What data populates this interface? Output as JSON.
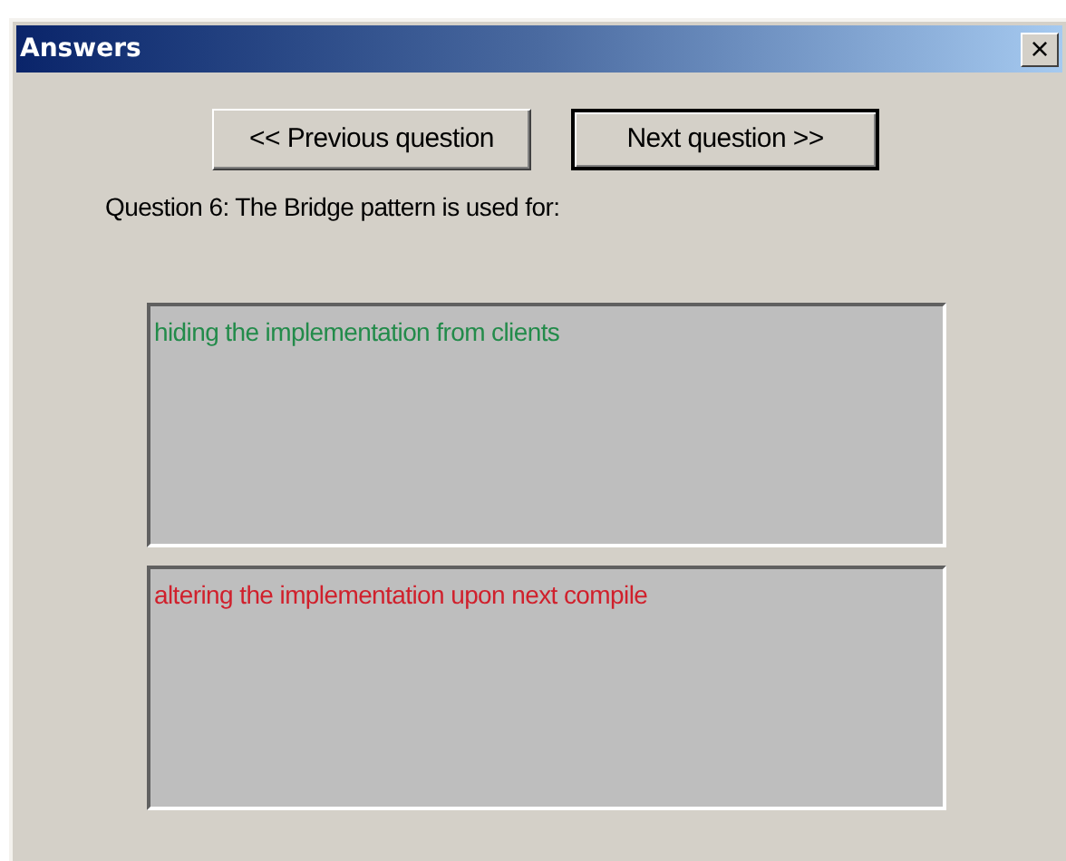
{
  "window": {
    "title": "Answers",
    "close": "×"
  },
  "buttons": [
    {
      "label": "<< Previous question",
      "default": false
    },
    {
      "label": "Next question >>",
      "default": true
    }
  ],
  "question": "Question 6: The Bridge pattern is used for:",
  "answers": [
    {
      "text": "hiding the implementation from clients",
      "correct": true
    },
    {
      "text": "altering the implementation upon next compile",
      "correct": false
    }
  ]
}
